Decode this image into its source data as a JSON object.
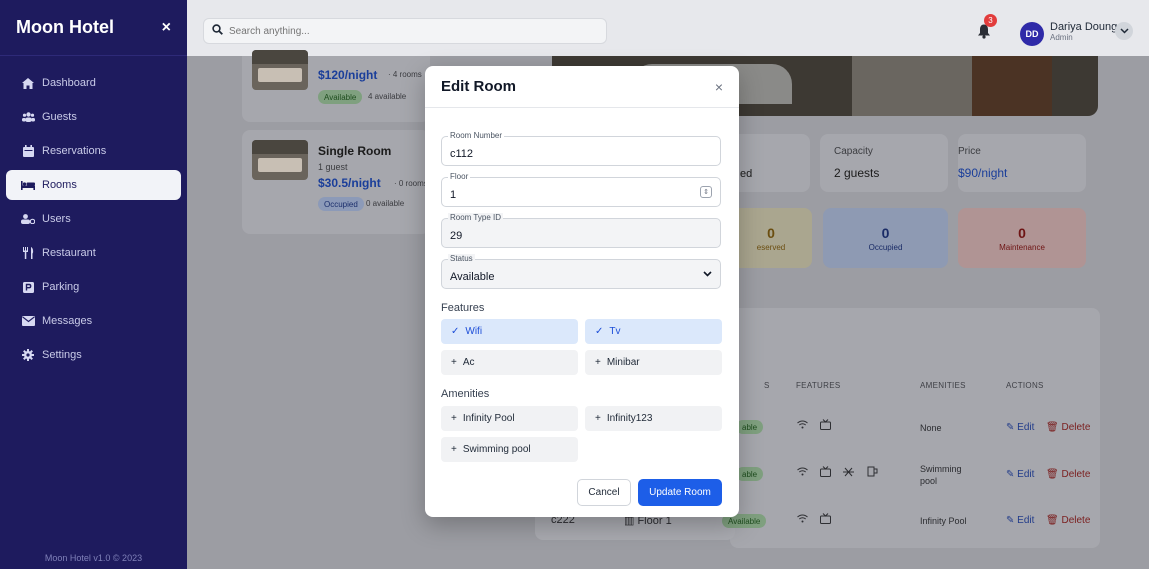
{
  "sidebar": {
    "brand": "Moon Hotel",
    "close_icon": "×",
    "items": [
      {
        "label": "Dashboard",
        "icon": "home-icon"
      },
      {
        "label": "Guests",
        "icon": "users-icon"
      },
      {
        "label": "Reservations",
        "icon": "calendar-icon"
      },
      {
        "label": "Rooms",
        "icon": "bed-icon"
      },
      {
        "label": "Users",
        "icon": "user-cog-icon"
      },
      {
        "label": "Restaurant",
        "icon": "utensils-icon"
      },
      {
        "label": "Parking",
        "icon": "parking-icon"
      },
      {
        "label": "Messages",
        "icon": "envelope-icon"
      },
      {
        "label": "Settings",
        "icon": "gear-icon"
      }
    ],
    "active_item": "Rooms",
    "footer": "Moon Hotel v1.0 © 2023"
  },
  "header": {
    "search_placeholder": "Search anything...",
    "notification_count": "3",
    "user_initials": "DD",
    "user_name": "Dariya Doung",
    "user_role": "Admin"
  },
  "background": {
    "room_cards": [
      {
        "title": "",
        "price": "$120/night",
        "rooms": "· 4 rooms",
        "status": "Available",
        "availability": "4 available"
      },
      {
        "title": "Single Room",
        "guests": "1 guest",
        "price": "$30.5/night",
        "rooms": "· 0 rooms",
        "status": "Occupied",
        "availability": "0 available"
      }
    ],
    "detail": {
      "partial_label": "ed",
      "capacity_label": "Capacity",
      "capacity_value": "2 guests",
      "price_label": "Price",
      "price_value": "$90/night"
    },
    "stats": [
      {
        "value": "0",
        "label": "eserved"
      },
      {
        "value": "0",
        "label": "Occupied"
      },
      {
        "value": "0",
        "label": "Maintenance"
      }
    ],
    "table": {
      "headers": [
        "S",
        "FEATURES",
        "AMENITIES",
        "ACTIONS"
      ],
      "rows": [
        {
          "status": "able",
          "amenities": "None"
        },
        {
          "status": "able",
          "amenities": "Swimming pool"
        },
        {
          "number": "c222",
          "floor": "Floor 1",
          "status": "Available",
          "amenities": "Infinity Pool"
        }
      ],
      "edit_label": "Edit",
      "delete_label": "Delete"
    }
  },
  "modal": {
    "title": "Edit Room",
    "close_icon": "×",
    "room_number_label": "Room Number",
    "room_number_value": "c112",
    "floor_label": "Floor",
    "floor_value": "1",
    "room_type_label": "Room Type ID",
    "room_type_value": "29",
    "status_label": "Status",
    "status_value": "Available",
    "features_label": "Features",
    "features": [
      {
        "label": "Wifi",
        "selected": true
      },
      {
        "label": "Tv",
        "selected": true
      },
      {
        "label": "Ac",
        "selected": false
      },
      {
        "label": "Minibar",
        "selected": false
      }
    ],
    "amenities_label": "Amenities",
    "amenities": [
      {
        "label": "Infinity Pool",
        "selected": false
      },
      {
        "label": "Infinity123",
        "selected": false
      },
      {
        "label": "Swimming pool",
        "selected": false
      }
    ],
    "cancel_label": "Cancel",
    "update_label": "Update Room"
  },
  "colors": {
    "sidebar_bg": "#1e1b5e",
    "accent": "#1d5ee8",
    "selected_chip": "#dbe8fb"
  }
}
